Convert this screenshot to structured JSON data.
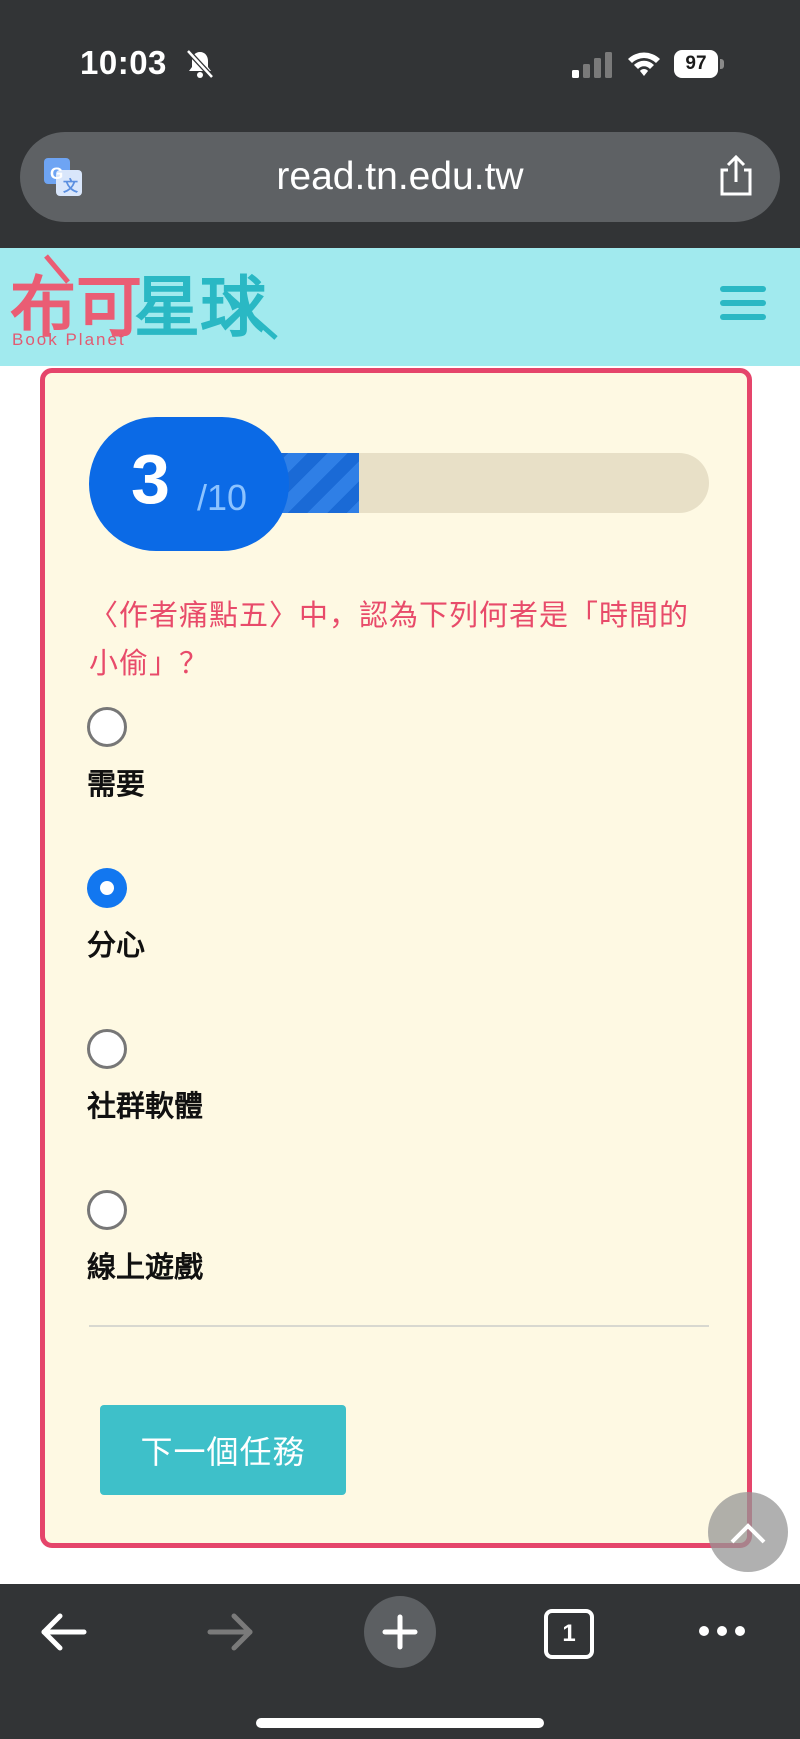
{
  "status_bar": {
    "time": "10:03",
    "battery": "97"
  },
  "browser": {
    "url": "read.tn.edu.tw"
  },
  "site": {
    "logo_text": "布可星球",
    "logo_subtitle": "Book Planet"
  },
  "quiz": {
    "progress": {
      "current": "3",
      "total": "/10",
      "fraction": 0.3
    },
    "question": "〈作者痛點五〉中，認為下列何者是「時間的小偷」？",
    "options": [
      {
        "label": "需要",
        "selected": false
      },
      {
        "label": "分心",
        "selected": true
      },
      {
        "label": "社群軟體",
        "selected": false
      },
      {
        "label": "線上遊戲",
        "selected": false
      }
    ],
    "next_label": "下一個任務"
  },
  "toolbar": {
    "tab_count": "1"
  },
  "colors": {
    "header_bg": "#a1eaee",
    "card_bg": "#fef9e3",
    "card_border": "#e5456b",
    "question_text": "#e84b6a",
    "progress_blue": "#0b6ae6",
    "button_teal": "#3ec0c9"
  }
}
